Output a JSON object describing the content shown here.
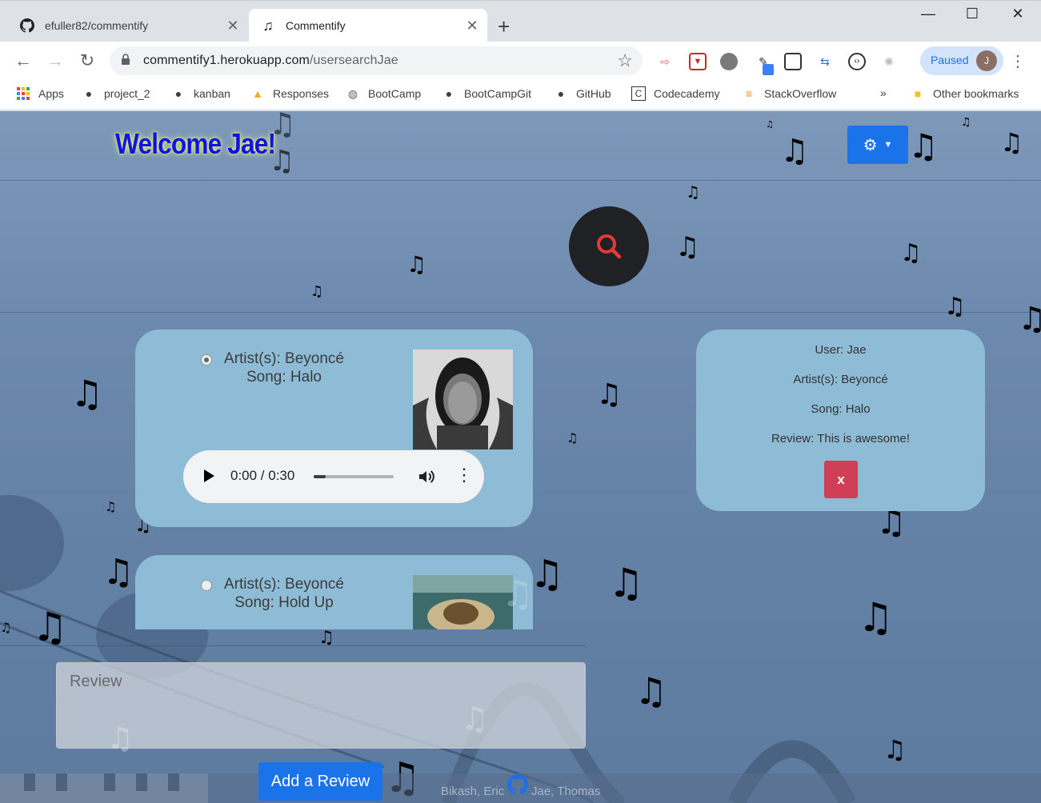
{
  "browser": {
    "tabs": [
      {
        "title": "efuller82/commentify",
        "icon": "github-icon"
      },
      {
        "title": "Commentify",
        "icon": "music-note-icon"
      }
    ],
    "url_host": "commentify1.herokuapp.com",
    "url_path": "/usersearchJae",
    "profile_status": "Paused",
    "profile_initial": "J",
    "bookmarks": [
      "Apps",
      "project_2",
      "kanban",
      "Responses",
      "BootCamp",
      "BootCampGit",
      "GitHub",
      "Codecademy",
      "StackOverflow"
    ],
    "bookmarks_overflow": "»",
    "other_bookmarks": "Other bookmarks"
  },
  "page": {
    "welcome": "Welcome Jae!",
    "results": [
      {
        "artist": "Artist(s): Beyoncé",
        "song": "Song: Halo",
        "selected": true
      },
      {
        "artist": "Artist(s): Beyoncé",
        "song": "Song: Hold Up",
        "selected": false
      }
    ],
    "player": {
      "time": "0:00 / 0:30",
      "progress": 0.15
    },
    "review_card": {
      "user": "User: Jae",
      "artist": "Artist(s): Beyoncé",
      "song": "Song: Halo",
      "review": "Review: This is awesome!",
      "delete_label": "x"
    },
    "review_placeholder": "Review",
    "add_review_label": "Add a Review",
    "credits_left": "Bikash, Eric",
    "credits_right": "Jae, Thomas"
  },
  "colors": {
    "accent_blue": "#1a73e8",
    "card": "#8ebbd5",
    "delete": "#cf3f55",
    "welcome_text": "#1212e8"
  }
}
